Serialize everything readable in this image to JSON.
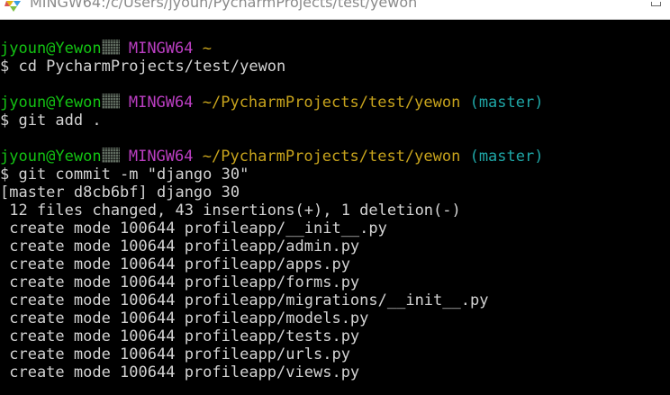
{
  "window": {
    "title": "MINGW64:/c/Users/jyoun/PycharmProjects/test/yewon",
    "icon": "mingw-diamond-icon"
  },
  "colors": {
    "user_host": "#13c313",
    "system": "#bb3ec2",
    "path": "#c7a31c",
    "branch": "#1fa7a7",
    "text": "#d4d4d4",
    "background": "#000000"
  },
  "prompts": [
    {
      "user_host": "jyoun@Yewon",
      "system": "MINGW64",
      "path": "~",
      "branch": "",
      "command": "$ cd PycharmProjects/test/yewon"
    },
    {
      "user_host": "jyoun@Yewon",
      "system": "MINGW64",
      "path": "~/PycharmProjects/test/yewon",
      "branch": "(master)",
      "command": "$ git add ."
    },
    {
      "user_host": "jyoun@Yewon",
      "system": "MINGW64",
      "path": "~/PycharmProjects/test/yewon",
      "branch": "(master)",
      "command": "$ git commit -m \"django 30\""
    }
  ],
  "output": [
    "[master d8cb6bf] django 30",
    " 12 files changed, 43 insertions(+), 1 deletion(-)",
    " create mode 100644 profileapp/__init__.py",
    " create mode 100644 profileapp/admin.py",
    " create mode 100644 profileapp/apps.py",
    " create mode 100644 profileapp/forms.py",
    " create mode 100644 profileapp/migrations/__init__.py",
    " create mode 100644 profileapp/models.py",
    " create mode 100644 profileapp/tests.py",
    " create mode 100644 profileapp/urls.py",
    " create mode 100644 profileapp/views.py"
  ]
}
